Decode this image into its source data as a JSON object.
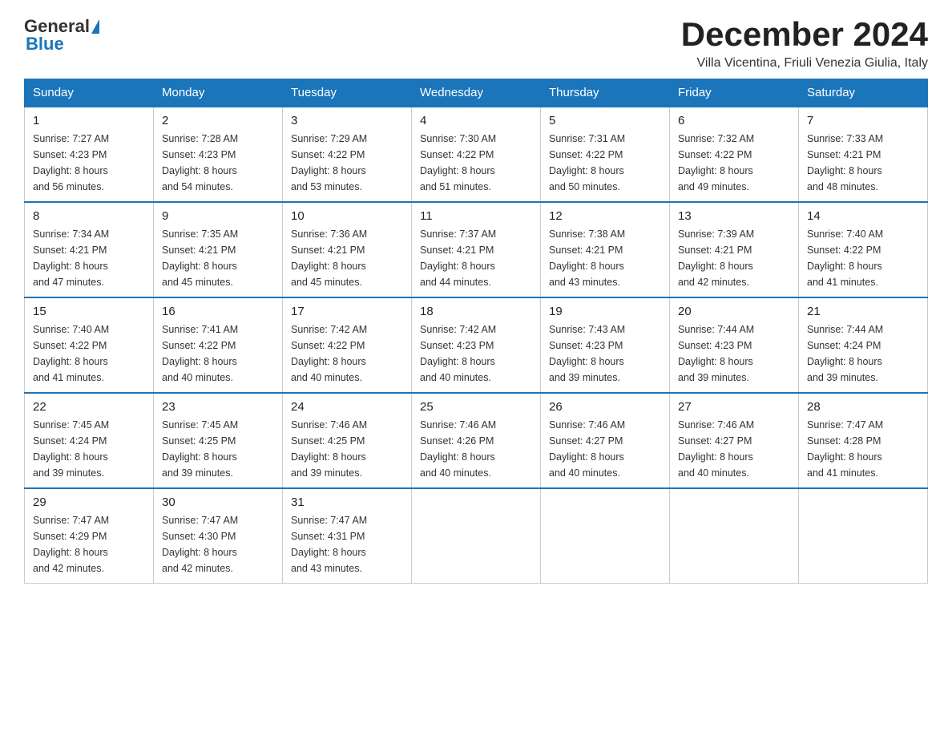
{
  "logo": {
    "general": "General",
    "blue": "Blue",
    "underline": "Blue"
  },
  "header": {
    "month_year": "December 2024",
    "location": "Villa Vicentina, Friuli Venezia Giulia, Italy"
  },
  "days_of_week": [
    "Sunday",
    "Monday",
    "Tuesday",
    "Wednesday",
    "Thursday",
    "Friday",
    "Saturday"
  ],
  "weeks": [
    [
      {
        "day": "1",
        "sunrise": "7:27 AM",
        "sunset": "4:23 PM",
        "daylight": "8 hours and 56 minutes."
      },
      {
        "day": "2",
        "sunrise": "7:28 AM",
        "sunset": "4:23 PM",
        "daylight": "8 hours and 54 minutes."
      },
      {
        "day": "3",
        "sunrise": "7:29 AM",
        "sunset": "4:22 PM",
        "daylight": "8 hours and 53 minutes."
      },
      {
        "day": "4",
        "sunrise": "7:30 AM",
        "sunset": "4:22 PM",
        "daylight": "8 hours and 51 minutes."
      },
      {
        "day": "5",
        "sunrise": "7:31 AM",
        "sunset": "4:22 PM",
        "daylight": "8 hours and 50 minutes."
      },
      {
        "day": "6",
        "sunrise": "7:32 AM",
        "sunset": "4:22 PM",
        "daylight": "8 hours and 49 minutes."
      },
      {
        "day": "7",
        "sunrise": "7:33 AM",
        "sunset": "4:21 PM",
        "daylight": "8 hours and 48 minutes."
      }
    ],
    [
      {
        "day": "8",
        "sunrise": "7:34 AM",
        "sunset": "4:21 PM",
        "daylight": "8 hours and 47 minutes."
      },
      {
        "day": "9",
        "sunrise": "7:35 AM",
        "sunset": "4:21 PM",
        "daylight": "8 hours and 45 minutes."
      },
      {
        "day": "10",
        "sunrise": "7:36 AM",
        "sunset": "4:21 PM",
        "daylight": "8 hours and 45 minutes."
      },
      {
        "day": "11",
        "sunrise": "7:37 AM",
        "sunset": "4:21 PM",
        "daylight": "8 hours and 44 minutes."
      },
      {
        "day": "12",
        "sunrise": "7:38 AM",
        "sunset": "4:21 PM",
        "daylight": "8 hours and 43 minutes."
      },
      {
        "day": "13",
        "sunrise": "7:39 AM",
        "sunset": "4:21 PM",
        "daylight": "8 hours and 42 minutes."
      },
      {
        "day": "14",
        "sunrise": "7:40 AM",
        "sunset": "4:22 PM",
        "daylight": "8 hours and 41 minutes."
      }
    ],
    [
      {
        "day": "15",
        "sunrise": "7:40 AM",
        "sunset": "4:22 PM",
        "daylight": "8 hours and 41 minutes."
      },
      {
        "day": "16",
        "sunrise": "7:41 AM",
        "sunset": "4:22 PM",
        "daylight": "8 hours and 40 minutes."
      },
      {
        "day": "17",
        "sunrise": "7:42 AM",
        "sunset": "4:22 PM",
        "daylight": "8 hours and 40 minutes."
      },
      {
        "day": "18",
        "sunrise": "7:42 AM",
        "sunset": "4:23 PM",
        "daylight": "8 hours and 40 minutes."
      },
      {
        "day": "19",
        "sunrise": "7:43 AM",
        "sunset": "4:23 PM",
        "daylight": "8 hours and 39 minutes."
      },
      {
        "day": "20",
        "sunrise": "7:44 AM",
        "sunset": "4:23 PM",
        "daylight": "8 hours and 39 minutes."
      },
      {
        "day": "21",
        "sunrise": "7:44 AM",
        "sunset": "4:24 PM",
        "daylight": "8 hours and 39 minutes."
      }
    ],
    [
      {
        "day": "22",
        "sunrise": "7:45 AM",
        "sunset": "4:24 PM",
        "daylight": "8 hours and 39 minutes."
      },
      {
        "day": "23",
        "sunrise": "7:45 AM",
        "sunset": "4:25 PM",
        "daylight": "8 hours and 39 minutes."
      },
      {
        "day": "24",
        "sunrise": "7:46 AM",
        "sunset": "4:25 PM",
        "daylight": "8 hours and 39 minutes."
      },
      {
        "day": "25",
        "sunrise": "7:46 AM",
        "sunset": "4:26 PM",
        "daylight": "8 hours and 40 minutes."
      },
      {
        "day": "26",
        "sunrise": "7:46 AM",
        "sunset": "4:27 PM",
        "daylight": "8 hours and 40 minutes."
      },
      {
        "day": "27",
        "sunrise": "7:46 AM",
        "sunset": "4:27 PM",
        "daylight": "8 hours and 40 minutes."
      },
      {
        "day": "28",
        "sunrise": "7:47 AM",
        "sunset": "4:28 PM",
        "daylight": "8 hours and 41 minutes."
      }
    ],
    [
      {
        "day": "29",
        "sunrise": "7:47 AM",
        "sunset": "4:29 PM",
        "daylight": "8 hours and 42 minutes."
      },
      {
        "day": "30",
        "sunrise": "7:47 AM",
        "sunset": "4:30 PM",
        "daylight": "8 hours and 42 minutes."
      },
      {
        "day": "31",
        "sunrise": "7:47 AM",
        "sunset": "4:31 PM",
        "daylight": "8 hours and 43 minutes."
      },
      null,
      null,
      null,
      null
    ]
  ],
  "labels": {
    "sunrise": "Sunrise:",
    "sunset": "Sunset:",
    "daylight": "Daylight:"
  }
}
